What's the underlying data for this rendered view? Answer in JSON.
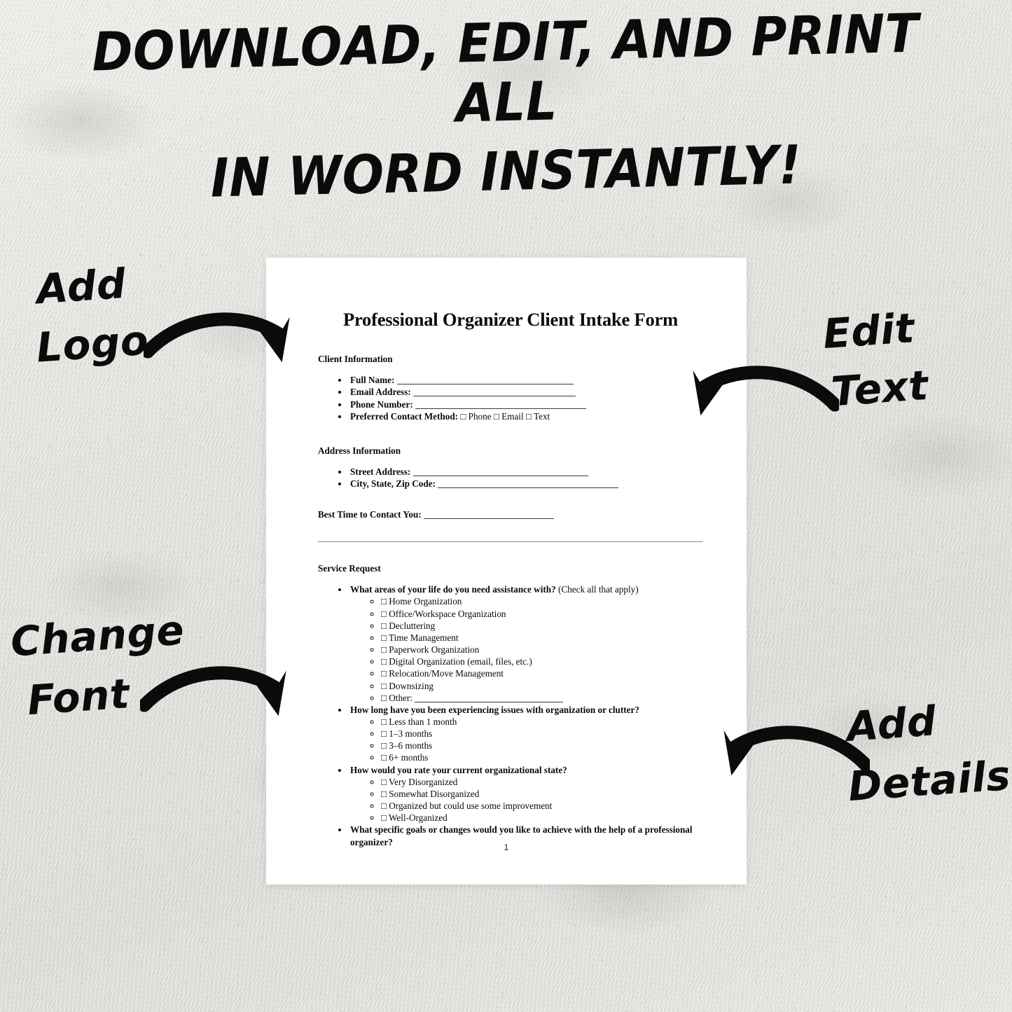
{
  "headline": {
    "line1": "DOWNLOAD, EDIT, AND PRINT ALL",
    "line2": "IN WORD INSTANTLY!"
  },
  "callouts": [
    {
      "id": "add-logo",
      "word1": "Add",
      "word2": "Logo",
      "arrow": "curved-arrow-right-down-icon"
    },
    {
      "id": "edit-text",
      "word1": "Edit",
      "word2": "Text",
      "arrow": "curved-arrow-left-down-icon"
    },
    {
      "id": "change-font",
      "word1": "Change",
      "word2": "Font",
      "arrow": "curved-arrow-right-down-icon"
    },
    {
      "id": "add-details",
      "word1": "Add",
      "word2": "Details",
      "arrow": "curved-arrow-left-down-icon"
    }
  ],
  "document": {
    "title": "Professional Organizer Client Intake Form",
    "page_number": "1",
    "sections": {
      "client_information": {
        "heading": "Client Information",
        "fields": [
          {
            "label": "Full Name:",
            "value": ""
          },
          {
            "label": "Email Address:",
            "value": ""
          },
          {
            "label": "Phone Number:",
            "value": ""
          }
        ],
        "preferred_contact": {
          "label": "Preferred Contact Method:",
          "options": [
            "Phone",
            "Email",
            "Text"
          ]
        }
      },
      "address_information": {
        "heading": "Address Information",
        "fields": [
          {
            "label": "Street Address:",
            "value": ""
          },
          {
            "label": "City, State, Zip Code:",
            "value": ""
          }
        ]
      },
      "best_time": {
        "label": "Best Time to Contact You:",
        "value": ""
      },
      "service_request": {
        "heading": "Service Request",
        "questions": [
          {
            "text": "What areas of your life do you need assistance with?",
            "note": "(Check all that apply)",
            "options": [
              "Home Organization",
              "Office/Workspace Organization",
              "Decluttering",
              "Time Management",
              "Paperwork Organization",
              "Digital Organization (email, files, etc.)",
              "Relocation/Move Management",
              "Downsizing",
              "Other:"
            ]
          },
          {
            "text": "How long have you been experiencing issues with organization or clutter?",
            "note": "",
            "options": [
              "Less than 1 month",
              "1–3 months",
              "3–6 months",
              "6+ months"
            ]
          },
          {
            "text": "How would you rate your current organizational state?",
            "note": "",
            "options": [
              "Very Disorganized",
              "Somewhat Disorganized",
              "Organized but could use some improvement",
              "Well-Organized"
            ]
          },
          {
            "text": "What specific goals or changes would you like to achieve with the help of a professional organizer?",
            "note": "",
            "options": []
          }
        ]
      }
    },
    "checkbox_glyph": "□"
  },
  "colors": {
    "background": "#e9e7e3",
    "page": "#ffffff",
    "ink": "#0a0a0a",
    "accent": "#0b0b0b"
  }
}
